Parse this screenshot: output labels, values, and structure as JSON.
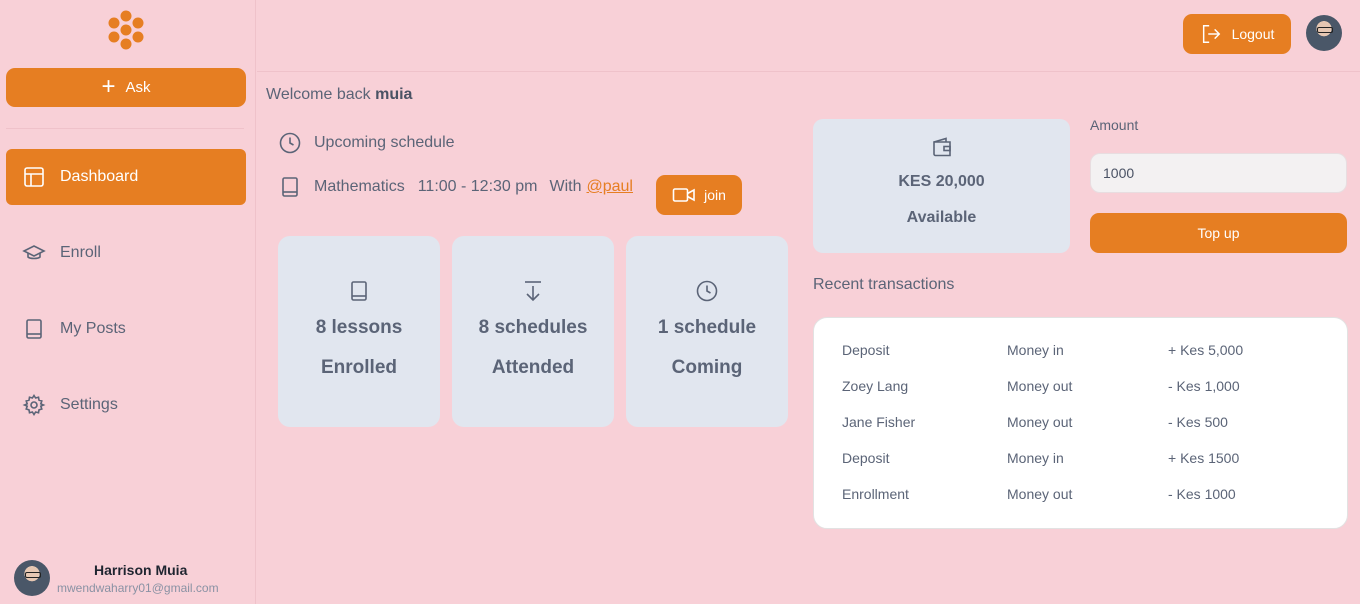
{
  "sidebar": {
    "ask_label": "Ask",
    "nav": [
      {
        "label": "Dashboard",
        "icon": "layout-icon",
        "active": true
      },
      {
        "label": "Enroll",
        "icon": "graduation-cap-icon",
        "active": false
      },
      {
        "label": "My Posts",
        "icon": "book-icon",
        "active": false
      },
      {
        "label": "Settings",
        "icon": "gear-icon",
        "active": false
      }
    ],
    "user": {
      "name": "Harrison Muia",
      "email": "mwendwaharry01@gmail.com"
    }
  },
  "header": {
    "logout_label": "Logout"
  },
  "main": {
    "welcome_prefix": "Welcome back",
    "welcome_name": "muia",
    "schedule_title": "Upcoming schedule",
    "schedule": {
      "subject": "Mathematics",
      "time": "11:00 - 12:30 pm",
      "with_label": "With",
      "teacher": "@paul",
      "join_label": "join"
    },
    "stats": [
      {
        "icon": "book-icon",
        "value": "8 lessons",
        "label": "Enrolled"
      },
      {
        "icon": "download-arrow-icon",
        "value": "8 schedules",
        "label": "Attended"
      },
      {
        "icon": "clock-icon",
        "value": "1 schedule",
        "label": "Coming"
      }
    ]
  },
  "wallet": {
    "amount": "KES 20,000",
    "label": "Available",
    "amount_field_label": "Amount",
    "amount_value": "1000",
    "topup_label": "Top up"
  },
  "transactions": {
    "title": "Recent transactions",
    "rows": [
      {
        "name": "Deposit",
        "type": "Money in",
        "amount": "+ Kes 5,000"
      },
      {
        "name": "Zoey Lang",
        "type": "Money out",
        "amount": "- Kes 1,000"
      },
      {
        "name": "Jane Fisher",
        "type": "Money out",
        "amount": "- Kes 500"
      },
      {
        "name": "Deposit",
        "type": "Money in",
        "amount": "+ Kes 1500"
      },
      {
        "name": "Enrollment",
        "type": "Money out",
        "amount": "- Kes 1000"
      }
    ]
  },
  "colors": {
    "accent": "#e67e22",
    "background": "#f8d0d7",
    "card": "#e1e6ef"
  }
}
